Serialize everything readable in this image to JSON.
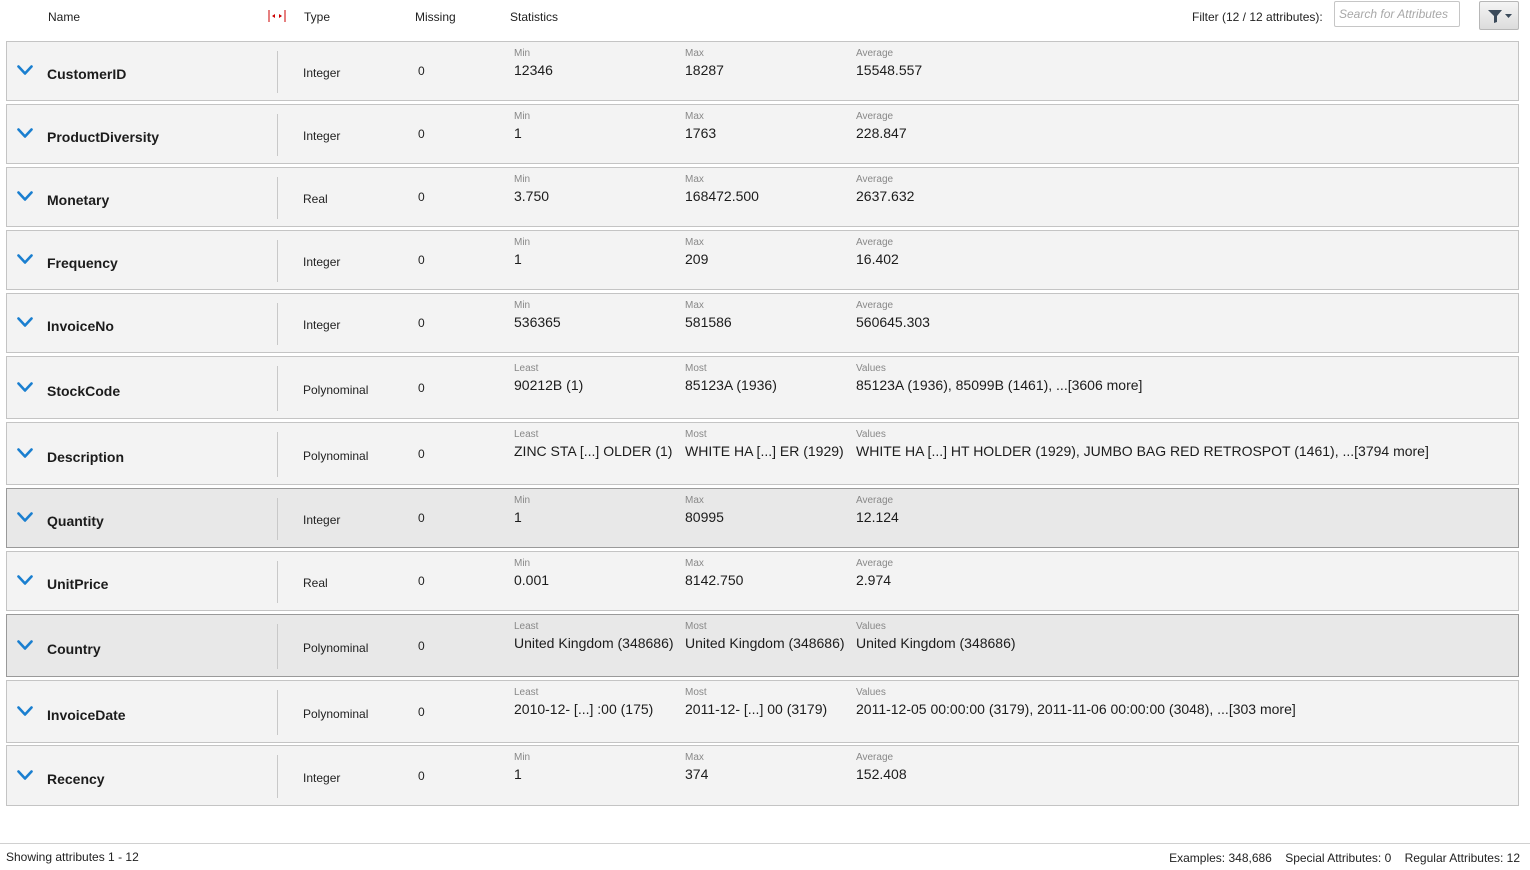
{
  "header": {
    "name": "Name",
    "type": "Type",
    "missing": "Missing",
    "statistics": "Statistics",
    "filter_label": "Filter (12 / 12 attributes):",
    "search_placeholder": "Search for Attributes"
  },
  "accent_color": "#1a7fd0",
  "attributes": [
    {
      "name": "CustomerID",
      "type": "Integer",
      "missing": "0",
      "l1": "Min",
      "v1": "12346",
      "l2": "Max",
      "v2": "18287",
      "l3": "Average",
      "v3": "15548.557"
    },
    {
      "name": "ProductDiversity",
      "type": "Integer",
      "missing": "0",
      "l1": "Min",
      "v1": "1",
      "l2": "Max",
      "v2": "1763",
      "l3": "Average",
      "v3": "228.847"
    },
    {
      "name": "Monetary",
      "type": "Real",
      "missing": "0",
      "l1": "Min",
      "v1": "3.750",
      "l2": "Max",
      "v2": "168472.500",
      "l3": "Average",
      "v3": "2637.632"
    },
    {
      "name": "Frequency",
      "type": "Integer",
      "missing": "0",
      "l1": "Min",
      "v1": "1",
      "l2": "Max",
      "v2": "209",
      "l3": "Average",
      "v3": "16.402"
    },
    {
      "name": "InvoiceNo",
      "type": "Integer",
      "missing": "0",
      "l1": "Min",
      "v1": "536365",
      "l2": "Max",
      "v2": "581586",
      "l3": "Average",
      "v3": "560645.303"
    },
    {
      "name": "StockCode",
      "type": "Polynominal",
      "missing": "0",
      "l1": "Least",
      "v1": "90212B (1)",
      "l2": "Most",
      "v2": "85123A (1936)",
      "l3": "Values",
      "v3": "85123A (1936), 85099B (1461), ...[3606 more]"
    },
    {
      "name": "Description",
      "type": "Polynominal",
      "missing": "0",
      "l1": "Least",
      "v1": "ZINC STA [...] OLDER (1)",
      "l2": "Most",
      "v2": "WHITE HA [...] ER (1929)",
      "l3": "Values",
      "v3": "WHITE HA [...] HT HOLDER (1929), JUMBO BAG RED RETROSPOT (1461), ...[3794 more]"
    },
    {
      "name": "Quantity",
      "type": "Integer",
      "missing": "0",
      "l1": "Min",
      "v1": "1",
      "l2": "Max",
      "v2": "80995",
      "l3": "Average",
      "v3": "12.124"
    },
    {
      "name": "UnitPrice",
      "type": "Real",
      "missing": "0",
      "l1": "Min",
      "v1": "0.001",
      "l2": "Max",
      "v2": "8142.750",
      "l3": "Average",
      "v3": "2.974"
    },
    {
      "name": "Country",
      "type": "Polynominal",
      "missing": "0",
      "l1": "Least",
      "v1": "United Kingdom (348686)",
      "l2": "Most",
      "v2": "United Kingdom (348686)",
      "l3": "Values",
      "v3": "United Kingdom (348686)"
    },
    {
      "name": "InvoiceDate",
      "type": "Polynominal",
      "missing": "0",
      "l1": "Least",
      "v1": "2010-12- [...] :00 (175)",
      "l2": "Most",
      "v2": "2011-12- [...] 00 (3179)",
      "l3": "Values",
      "v3": "2011-12-05 00:00:00 (3179), 2011-11-06 00:00:00 (3048), ...[303 more]"
    },
    {
      "name": "Recency",
      "type": "Integer",
      "missing": "0",
      "l1": "Min",
      "v1": "1",
      "l2": "Max",
      "v2": "374",
      "l3": "Average",
      "v3": "152.408"
    }
  ],
  "footer": {
    "showing": "Showing attributes 1 - 12",
    "examples": "Examples: 348,686",
    "special": "Special Attributes: 0",
    "regular": "Regular Attributes: 12"
  }
}
